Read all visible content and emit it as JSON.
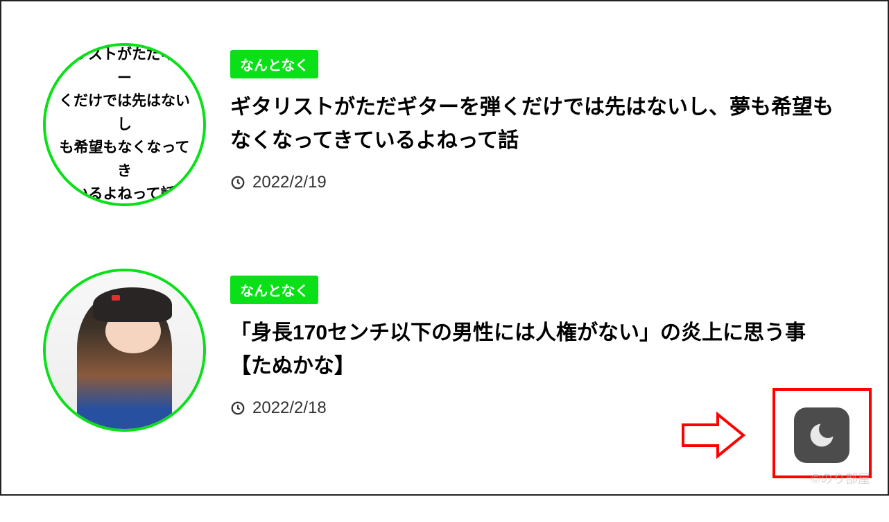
{
  "articles": [
    {
      "category": "なんとなく",
      "title": "ギタリストがただギターを弾くだけでは先はないし、夢も希望もなくなってきているよねって話",
      "date": "2022/2/19",
      "thumbnail_text": "タリストがただギター\nくだけでは先はないし\nも希望もなくなってき\nいるよねって話"
    },
    {
      "category": "なんとなく",
      "title": "「身長170センチ以下の男性には人権がない」の炎上に思う事【たぬかな】",
      "date": "2022/2/18",
      "thumbnail_text": ""
    }
  ],
  "watermark": "©のり部屋",
  "colors": {
    "accent": "#0ae018",
    "highlight": "#ff0000",
    "dark_button": "#4c4c4c"
  }
}
